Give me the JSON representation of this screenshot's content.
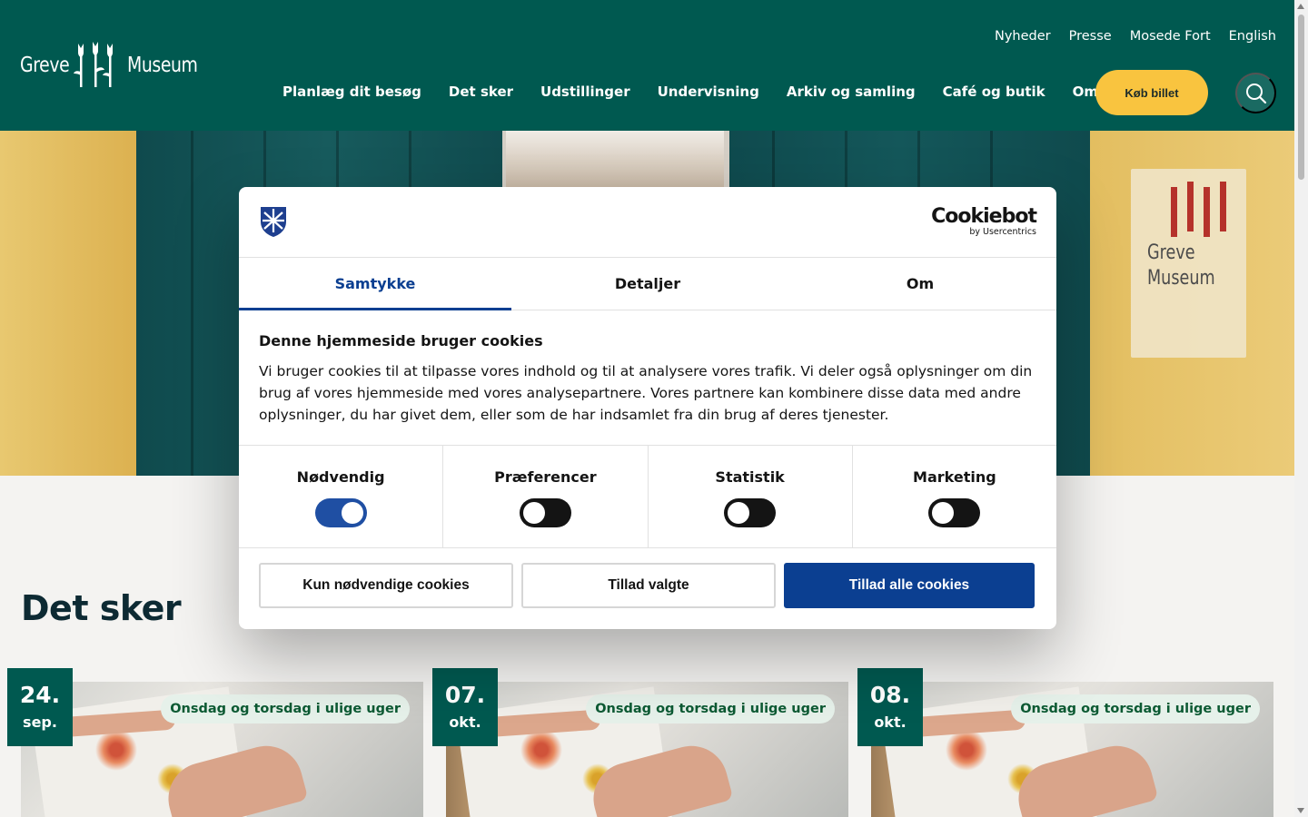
{
  "header": {
    "logo_left": "Greve",
    "logo_right": "Museum",
    "top_links": [
      "Nyheder",
      "Presse",
      "Mosede Fort",
      "English"
    ],
    "nav": [
      "Planlæg dit besøg",
      "Det sker",
      "Udstillinger",
      "Undervisning",
      "Arkiv og samling",
      "Café og butik",
      "Om museet"
    ],
    "buy_button": "Køb billet",
    "search_icon": "search-icon",
    "colors": {
      "header_bg": "#005950",
      "buy_button_bg": "#f9c43f"
    }
  },
  "hero": {
    "sign_line1": "Greve",
    "sign_line2": "Museum"
  },
  "cookie_dialog": {
    "brand": "Cookiebot",
    "brand_sub": "by Usercentrics",
    "tabs": [
      {
        "label": "Samtykke",
        "active": true
      },
      {
        "label": "Detaljer",
        "active": false
      },
      {
        "label": "Om",
        "active": false
      }
    ],
    "heading": "Denne hjemmeside bruger cookies",
    "body": "Vi bruger cookies til at tilpasse vores indhold og til at analysere vores trafik. Vi deler også oplysninger om din brug af vores hjemmeside med vores analysepartnere. Vores partnere kan kombinere disse data med andre oplysninger, du har givet dem, eller som de har indsamlet fra din brug af deres tjenester.",
    "toggles": [
      {
        "label": "Nødvendig",
        "on": true
      },
      {
        "label": "Præferencer",
        "on": false
      },
      {
        "label": "Statistik",
        "on": false
      },
      {
        "label": "Marketing",
        "on": false
      }
    ],
    "buttons": {
      "necessary_only": "Kun nødvendige cookies",
      "allow_selected": "Tillad valgte",
      "allow_all": "Tillad alle cookies"
    },
    "colors": {
      "accent": "#0b3f91"
    }
  },
  "events": {
    "title": "Det sker",
    "items": [
      {
        "day": "24.",
        "month": "sep.",
        "tag": "Onsdag og torsdag i ulige uger"
      },
      {
        "day": "07.",
        "month": "okt.",
        "tag": "Onsdag og torsdag i ulige uger"
      },
      {
        "day": "08.",
        "month": "okt.",
        "tag": "Onsdag og torsdag i ulige uger"
      }
    ]
  }
}
